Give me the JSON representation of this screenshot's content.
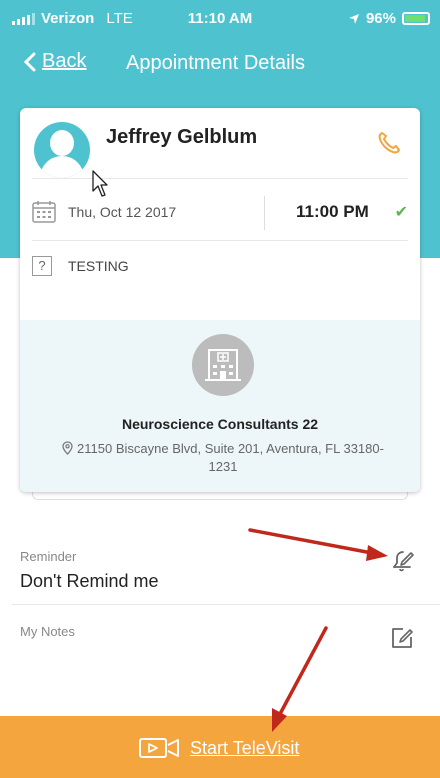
{
  "status_bar": {
    "carrier": "Verizon",
    "network": "LTE",
    "time": "11:10 AM",
    "battery": "96%"
  },
  "nav": {
    "back_label": "Back",
    "title": "Appointment Details"
  },
  "appointment": {
    "doctor_name": "Jeffrey Gelblum",
    "date": "Thu, Oct 12  2017",
    "time": "11:00 PM",
    "reason": "TESTING",
    "clinic_name": "Neuroscience Consultants 22",
    "clinic_address": "21150 Biscayne Blvd, Suite 201, Aventura, FL 33180-1231"
  },
  "reminder": {
    "label": "Reminder",
    "value": "Don't Remind me"
  },
  "notes": {
    "label": "My Notes"
  },
  "cta": {
    "label": "Start TeleVisit"
  },
  "colors": {
    "header": "#4ec3cf",
    "accent": "#f5a53e",
    "check": "#5bb84d",
    "annotation_arrow": "#c0281c"
  }
}
